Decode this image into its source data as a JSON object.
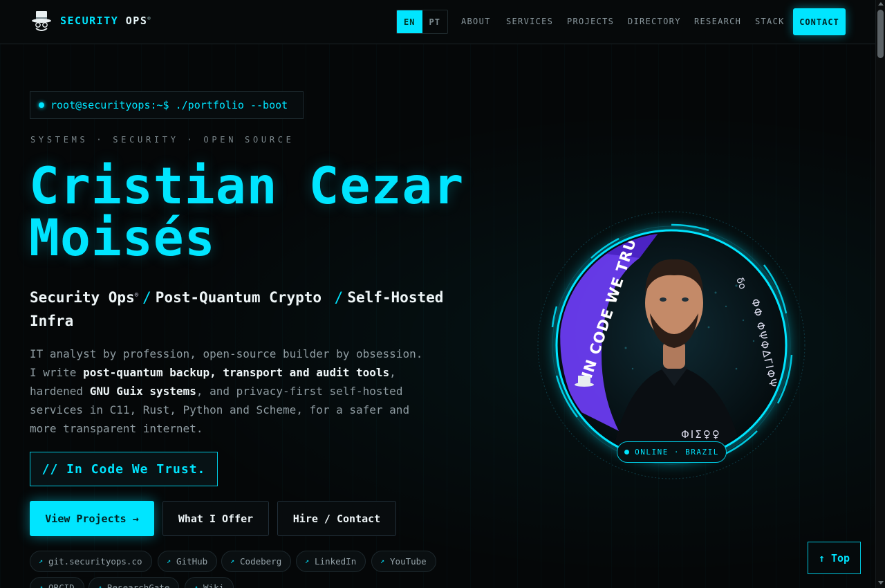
{
  "header": {
    "brand_primary": "SECURITY",
    "brand_secondary": "OPS",
    "brand_mark": "®",
    "languages": [
      "EN",
      "PT"
    ],
    "active_language": "EN",
    "nav": [
      "ABOUT",
      "SERVICES",
      "PROJECTS",
      "DIRECTORY",
      "RESEARCH",
      "STACK"
    ],
    "contact_label": "CONTACT"
  },
  "hero": {
    "prompt": "root@securityops:~$ ./portfolio --boot",
    "kicker": "SYSTEMS · SECURITY · OPEN SOURCE",
    "name_line1": "Cristian Cezar",
    "name_line2": "Moisés",
    "role1": "Security Ops",
    "role1_mark": "®",
    "role_sep": "/",
    "role2": "Post-Quantum Crypto",
    "role3": "Self-Hosted Infra",
    "bio": {
      "p1": "IT analyst by profession, open-source builder by obsession. I write ",
      "b1": "post-quantum backup, transport and audit tools",
      "p2": ", hardened ",
      "b2": "GNU Guix systems",
      "p3": ", and privacy-first self-hosted services in C11, Rust, Python and Scheme, for a safer and more transparent internet."
    },
    "motto": "// In Code We Trust.",
    "buttons": {
      "primary": "View Projects →",
      "offer": "What I Offer",
      "hire": "Hire / Contact"
    },
    "links": [
      "git.securityops.co",
      "GitHub",
      "Codeberg",
      "LinkedIn",
      "YouTube",
      "ORCID",
      "ResearchGate",
      "Wiki"
    ],
    "link_arrow": "↗"
  },
  "avatar": {
    "banner_text": "IN CODE WE TRUST",
    "status": "ONLINE · BRAZIL"
  },
  "back_to_top": "↑ Top",
  "colors": {
    "accent": "#00e5ff",
    "background": "#050708",
    "banner": "#6a3cf0"
  }
}
